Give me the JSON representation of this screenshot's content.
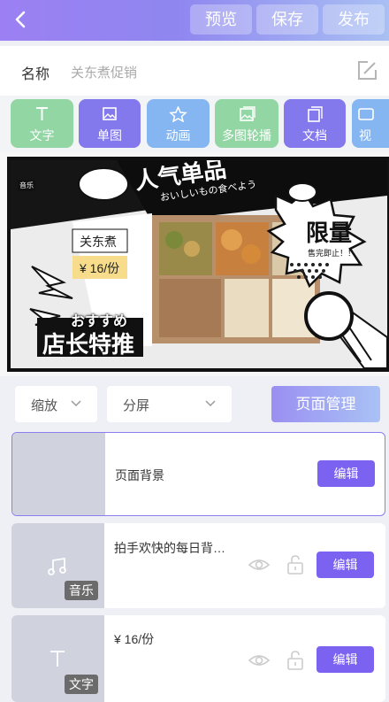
{
  "header": {
    "preview_label": "预览",
    "save_label": "保存",
    "publish_label": "发布"
  },
  "name_row": {
    "label": "名称",
    "value": "关东煮促销"
  },
  "tools": [
    {
      "label": "文字",
      "icon": "text-icon"
    },
    {
      "label": "单图",
      "icon": "image-icon"
    },
    {
      "label": "动画",
      "icon": "star-icon"
    },
    {
      "label": "多图轮播",
      "icon": "multi-image-icon"
    },
    {
      "label": "文档",
      "icon": "document-icon"
    },
    {
      "label": "视",
      "icon": "video-icon"
    }
  ],
  "poster": {
    "music_tag": "音乐",
    "headline": "人气单品",
    "headline_sub": "おいしいもの食べよう",
    "product_name": "关东煮",
    "product_price": "¥ 16/份",
    "limited": "限量",
    "limited_sub": "售完即止！！",
    "osusume": "おすすめ",
    "recommend": "店长特推"
  },
  "controls": {
    "zoom_label": "缩放",
    "split_label": "分屏",
    "page_manage_label": "页面管理"
  },
  "layers": [
    {
      "title": "页面背景",
      "edit_label": "编辑"
    },
    {
      "title": "拍手欢快的每日背…",
      "badge": "音乐",
      "edit_label": "编辑"
    },
    {
      "title": "¥ 16/份",
      "badge": "文字",
      "edit_label": "编辑"
    }
  ],
  "colors": {
    "accent": "#7c62f0",
    "green_tool": "#92d6a4",
    "purple_tool": "#8378ec",
    "blue_tool": "#86b6f1"
  }
}
